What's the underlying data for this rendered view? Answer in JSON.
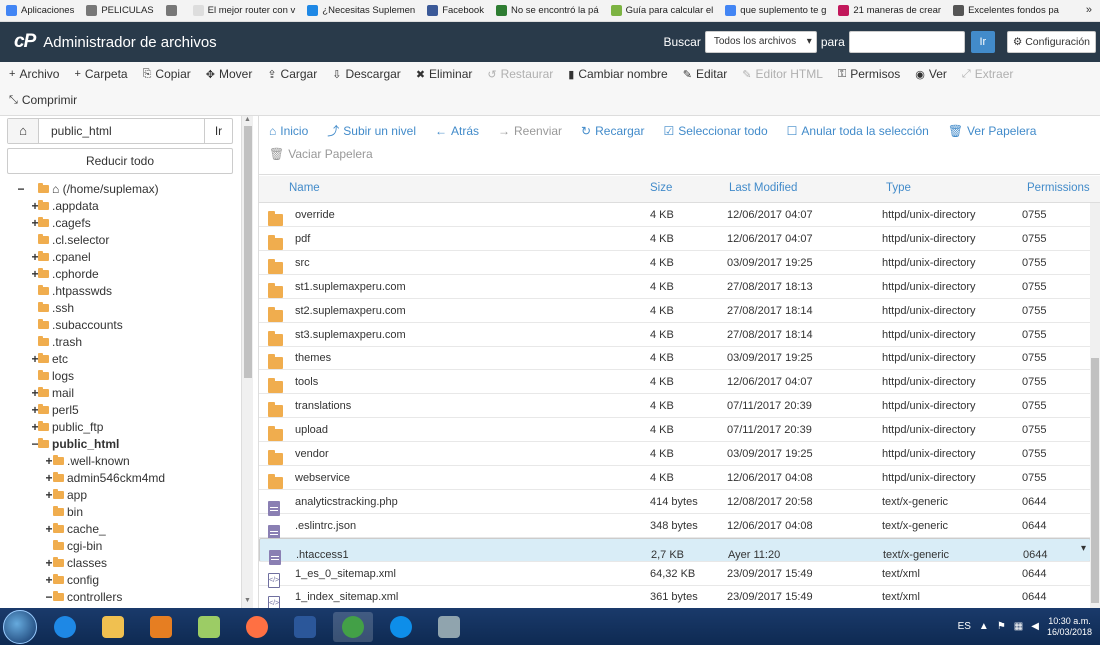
{
  "bookmarks": [
    {
      "label": "Aplicaciones",
      "color": "#4285f4"
    },
    {
      "label": "PELICULAS",
      "color": "#777777"
    },
    {
      "label": "",
      "color": "#777777"
    },
    {
      "label": "El mejor router con v",
      "color": "#dddddd"
    },
    {
      "label": "¿Necesitas Suplemen",
      "color": "#1e88e5"
    },
    {
      "label": "Facebook",
      "color": "#3b5998"
    },
    {
      "label": "No se encontró la pá",
      "color": "#2e7d32"
    },
    {
      "label": "Guía para calcular el",
      "color": "#7cb342"
    },
    {
      "label": "que suplemento te g",
      "color": "#4285f4"
    },
    {
      "label": "21 maneras de crear",
      "color": "#c2185b"
    },
    {
      "label": "Excelentes fondos pa",
      "color": "#555555"
    }
  ],
  "bookmarks_more": "»",
  "header": {
    "logo": "cP",
    "title": "Administrador de archivos",
    "search_label": "Buscar",
    "search_scope": "Todos los archivos",
    "para_label": "para",
    "go_label": "Ir",
    "settings_label": "Configuración"
  },
  "toolbar": {
    "row1": [
      {
        "icon": "plus-icon",
        "glyph": "+",
        "label": "Archivo",
        "disabled": false
      },
      {
        "icon": "plus-icon",
        "glyph": "+",
        "label": "Carpeta",
        "disabled": false
      },
      {
        "icon": "copy-icon",
        "glyph": "⎘",
        "label": "Copiar",
        "disabled": false
      },
      {
        "icon": "move-icon",
        "glyph": "✥",
        "label": "Mover",
        "disabled": false
      },
      {
        "icon": "upload-icon",
        "glyph": "⇪",
        "label": "Cargar",
        "disabled": false
      },
      {
        "icon": "download-icon",
        "glyph": "⇩",
        "label": "Descargar",
        "disabled": false
      },
      {
        "icon": "delete-icon",
        "glyph": "✖",
        "label": "Eliminar",
        "disabled": false
      },
      {
        "icon": "restore-icon",
        "glyph": "↺",
        "label": "Restaurar",
        "disabled": true
      },
      {
        "icon": "rename-icon",
        "glyph": "▮",
        "label": "Cambiar nombre",
        "disabled": false
      },
      {
        "icon": "edit-icon",
        "glyph": "✎",
        "label": "Editar",
        "disabled": false
      },
      {
        "icon": "html-editor-icon",
        "glyph": "✎",
        "label": "Editor HTML",
        "disabled": true
      },
      {
        "icon": "key-icon",
        "glyph": "⚿",
        "label": "Permisos",
        "disabled": false
      },
      {
        "icon": "eye-icon",
        "glyph": "◉",
        "label": "Ver",
        "disabled": false
      },
      {
        "icon": "extract-icon",
        "glyph": "⤢",
        "label": "Extraer",
        "disabled": true
      }
    ],
    "row2": [
      {
        "icon": "compress-icon",
        "glyph": "⤡",
        "label": "Comprimir",
        "disabled": false
      }
    ]
  },
  "sidebar": {
    "path_value": "public_html",
    "path_go": "Ir",
    "collapse_label": "Reducir todo",
    "tree": [
      {
        "label": "(/home/suplemax)",
        "toggle": "−",
        "depth": 0,
        "home": true,
        "bold": false
      },
      {
        "label": ".appdata",
        "toggle": "+",
        "depth": 1,
        "bold": false
      },
      {
        "label": ".cagefs",
        "toggle": "+",
        "depth": 1,
        "bold": false
      },
      {
        "label": ".cl.selector",
        "toggle": "",
        "depth": 1,
        "bold": false
      },
      {
        "label": ".cpanel",
        "toggle": "+",
        "depth": 1,
        "bold": false
      },
      {
        "label": ".cphorde",
        "toggle": "+",
        "depth": 1,
        "bold": false
      },
      {
        "label": ".htpasswds",
        "toggle": "",
        "depth": 1,
        "bold": false
      },
      {
        "label": ".ssh",
        "toggle": "",
        "depth": 1,
        "bold": false
      },
      {
        "label": ".subaccounts",
        "toggle": "",
        "depth": 1,
        "bold": false
      },
      {
        "label": ".trash",
        "toggle": "",
        "depth": 1,
        "bold": false
      },
      {
        "label": "etc",
        "toggle": "+",
        "depth": 1,
        "bold": false
      },
      {
        "label": "logs",
        "toggle": "",
        "depth": 1,
        "bold": false
      },
      {
        "label": "mail",
        "toggle": "+",
        "depth": 1,
        "bold": false
      },
      {
        "label": "perl5",
        "toggle": "+",
        "depth": 1,
        "bold": false
      },
      {
        "label": "public_ftp",
        "toggle": "+",
        "depth": 1,
        "bold": false
      },
      {
        "label": "public_html",
        "toggle": "−",
        "depth": 1,
        "bold": true
      },
      {
        "label": ".well-known",
        "toggle": "+",
        "depth": 2,
        "bold": false
      },
      {
        "label": "admin546ckm4md",
        "toggle": "+",
        "depth": 2,
        "bold": false
      },
      {
        "label": "app",
        "toggle": "+",
        "depth": 2,
        "bold": false
      },
      {
        "label": "bin",
        "toggle": "",
        "depth": 2,
        "bold": false
      },
      {
        "label": "cache_",
        "toggle": "+",
        "depth": 2,
        "bold": false
      },
      {
        "label": "cgi-bin",
        "toggle": "",
        "depth": 2,
        "bold": false
      },
      {
        "label": "classes",
        "toggle": "+",
        "depth": 2,
        "bold": false
      },
      {
        "label": "config",
        "toggle": "+",
        "depth": 2,
        "bold": false
      },
      {
        "label": "controllers",
        "toggle": "−",
        "depth": 2,
        "bold": false
      }
    ]
  },
  "actions": [
    {
      "icon": "home-icon",
      "glyph": "⌂",
      "label": "Inicio",
      "disabled": false
    },
    {
      "icon": "level-up-icon",
      "glyph": "⤴",
      "label": "Subir un nivel",
      "disabled": false
    },
    {
      "icon": "arrow-left-icon",
      "glyph": "←",
      "label": "Atrás",
      "disabled": false
    },
    {
      "icon": "arrow-right-icon",
      "glyph": "→",
      "label": "Reenviar",
      "disabled": true
    },
    {
      "icon": "refresh-icon",
      "glyph": "↻",
      "label": "Recargar",
      "disabled": false
    },
    {
      "icon": "check-icon",
      "glyph": "☑",
      "label": "Seleccionar todo",
      "disabled": false
    },
    {
      "icon": "square-icon",
      "glyph": "☐",
      "label": "Anular toda la selección",
      "disabled": false
    },
    {
      "icon": "trash-icon",
      "glyph": "🗑",
      "label": "Ver Papelera",
      "disabled": false
    },
    {
      "icon": "trash-icon",
      "glyph": "🗑",
      "label": "Vaciar Papelera",
      "disabled": true
    }
  ],
  "table": {
    "headers": {
      "name": "Name",
      "size": "Size",
      "modified": "Last Modified",
      "type": "Type",
      "perms": "Permissions"
    },
    "rows": [
      {
        "kind": "folder",
        "name": "override",
        "size": "4 KB",
        "modified": "12/06/2017 04:07",
        "type": "httpd/unix-directory",
        "perms": "0755"
      },
      {
        "kind": "folder",
        "name": "pdf",
        "size": "4 KB",
        "modified": "12/06/2017 04:07",
        "type": "httpd/unix-directory",
        "perms": "0755"
      },
      {
        "kind": "folder",
        "name": "src",
        "size": "4 KB",
        "modified": "03/09/2017 19:25",
        "type": "httpd/unix-directory",
        "perms": "0755"
      },
      {
        "kind": "folder",
        "name": "st1.suplemaxperu.com",
        "size": "4 KB",
        "modified": "27/08/2017 18:13",
        "type": "httpd/unix-directory",
        "perms": "0755"
      },
      {
        "kind": "folder",
        "name": "st2.suplemaxperu.com",
        "size": "4 KB",
        "modified": "27/08/2017 18:14",
        "type": "httpd/unix-directory",
        "perms": "0755"
      },
      {
        "kind": "folder",
        "name": "st3.suplemaxperu.com",
        "size": "4 KB",
        "modified": "27/08/2017 18:14",
        "type": "httpd/unix-directory",
        "perms": "0755"
      },
      {
        "kind": "folder",
        "name": "themes",
        "size": "4 KB",
        "modified": "03/09/2017 19:25",
        "type": "httpd/unix-directory",
        "perms": "0755"
      },
      {
        "kind": "folder",
        "name": "tools",
        "size": "4 KB",
        "modified": "12/06/2017 04:07",
        "type": "httpd/unix-directory",
        "perms": "0755"
      },
      {
        "kind": "folder",
        "name": "translations",
        "size": "4 KB",
        "modified": "07/11/2017 20:39",
        "type": "httpd/unix-directory",
        "perms": "0755"
      },
      {
        "kind": "folder",
        "name": "upload",
        "size": "4 KB",
        "modified": "07/11/2017 20:39",
        "type": "httpd/unix-directory",
        "perms": "0755"
      },
      {
        "kind": "folder",
        "name": "vendor",
        "size": "4 KB",
        "modified": "03/09/2017 19:25",
        "type": "httpd/unix-directory",
        "perms": "0755"
      },
      {
        "kind": "folder",
        "name": "webservice",
        "size": "4 KB",
        "modified": "12/06/2017 04:08",
        "type": "httpd/unix-directory",
        "perms": "0755"
      },
      {
        "kind": "file",
        "name": "analyticstracking.php",
        "size": "414 bytes",
        "modified": "12/08/2017 20:58",
        "type": "text/x-generic",
        "perms": "0644"
      },
      {
        "kind": "file",
        "name": ".eslintrc.json",
        "size": "348 bytes",
        "modified": "12/06/2017 04:08",
        "type": "text/x-generic",
        "perms": "0644"
      },
      {
        "kind": "file",
        "name": ".htaccess1",
        "size": "2,7 KB",
        "modified": "Ayer 11:20",
        "type": "text/x-generic",
        "perms": "0644",
        "selected": true
      },
      {
        "kind": "xml",
        "name": "1_es_0_sitemap.xml",
        "size": "64,32 KB",
        "modified": "23/09/2017 15:49",
        "type": "text/xml",
        "perms": "0644"
      },
      {
        "kind": "xml",
        "name": "1_index_sitemap.xml",
        "size": "361 bytes",
        "modified": "23/09/2017 15:49",
        "type": "text/xml",
        "perms": "0644"
      }
    ]
  },
  "taskbar": {
    "apps": [
      {
        "name": "ie",
        "color": "#1e88e5"
      },
      {
        "name": "explorer",
        "color": "#f0c050"
      },
      {
        "name": "media",
        "color": "#e67e22"
      },
      {
        "name": "folder",
        "color": "#9ccc65"
      },
      {
        "name": "firefox",
        "color": "#ff7043"
      },
      {
        "name": "word",
        "color": "#2b579a"
      },
      {
        "name": "chrome",
        "color": "#43a047",
        "active": true
      },
      {
        "name": "teamviewer",
        "color": "#0e8ee9"
      },
      {
        "name": "calculator",
        "color": "#90a4ae"
      }
    ],
    "lang": "ES",
    "time": "10:30 a.m.",
    "date": "16/03/2018"
  }
}
